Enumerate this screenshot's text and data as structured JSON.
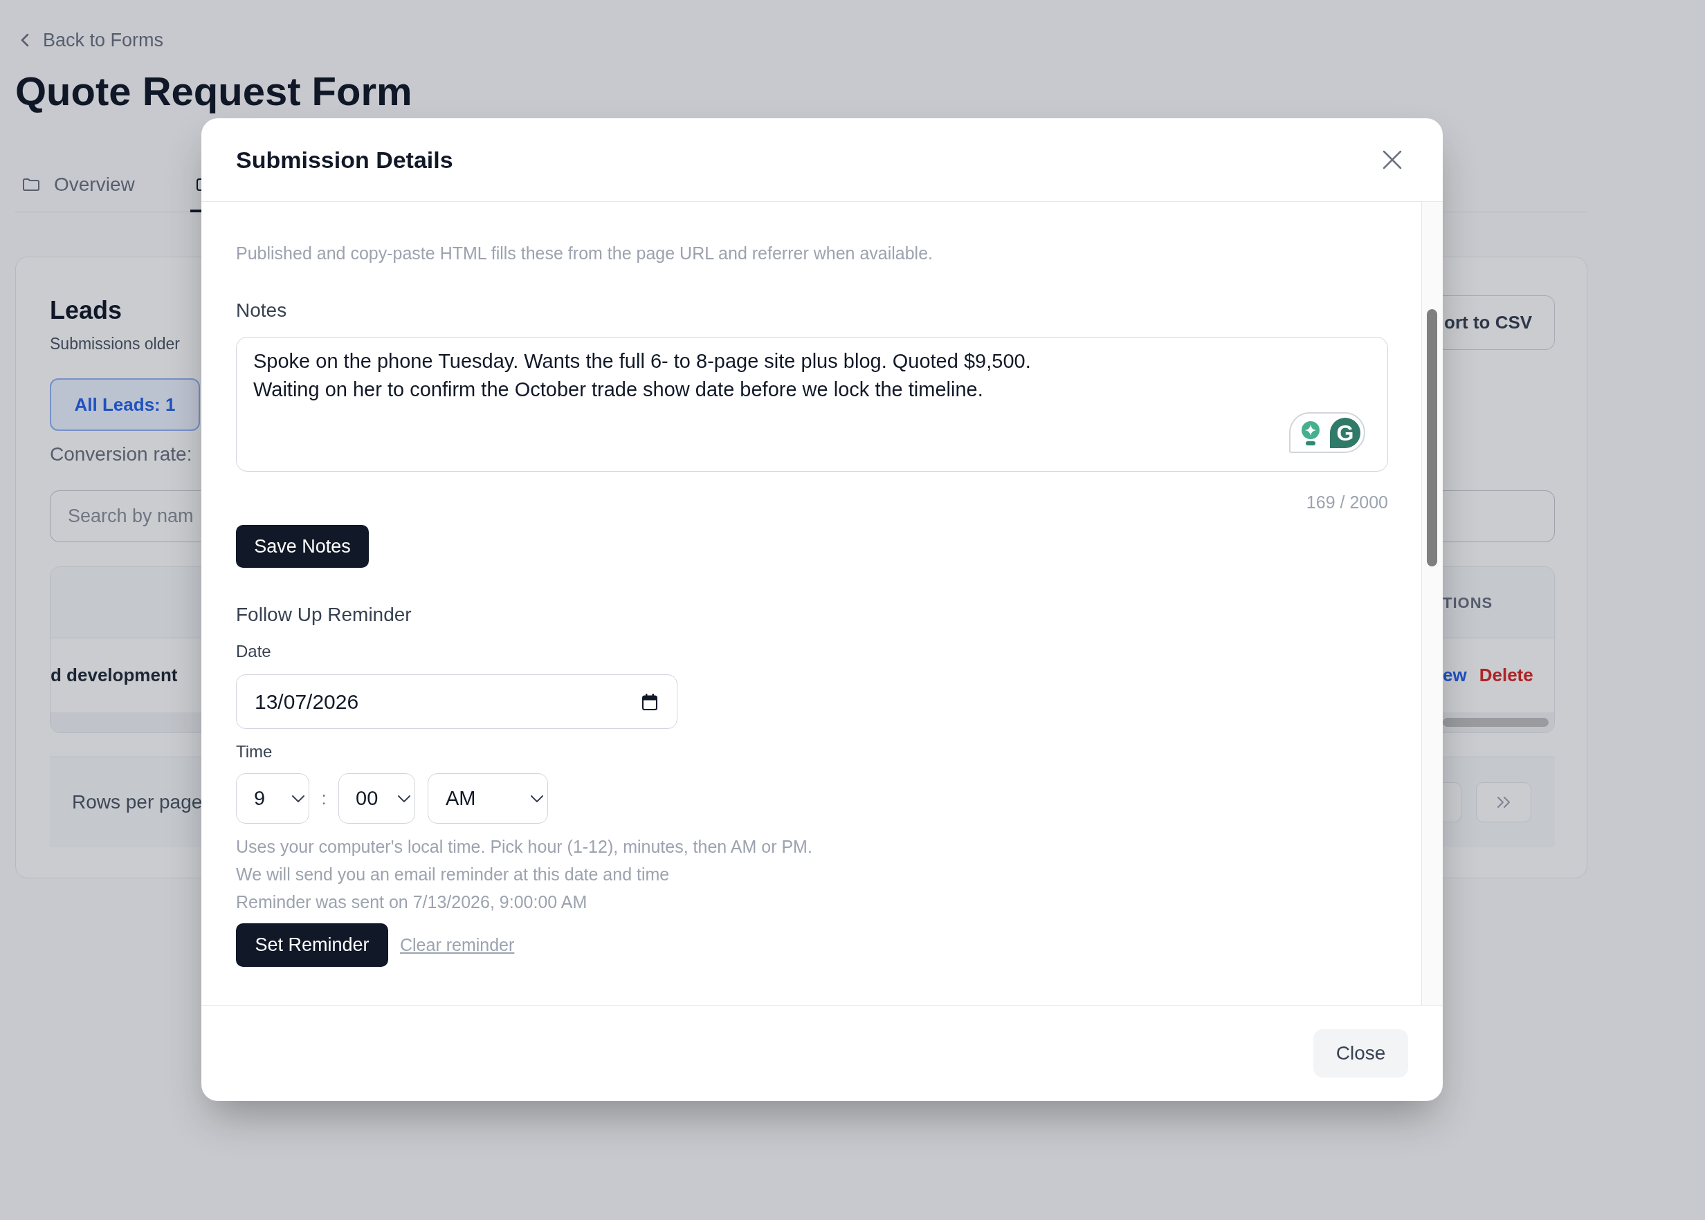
{
  "page": {
    "back_link": "Back to Forms",
    "title": "Quote Request Form",
    "tabs": [
      {
        "label": "Overview",
        "selected": false
      },
      {
        "selected": true
      }
    ],
    "leads_card": {
      "title": "Leads",
      "subtitle": "Submissions older",
      "export_button": "ort to CSV",
      "filter_chip": {
        "label": "All Leads: 1",
        "selected": true
      },
      "conversion_rate": "Conversion rate:",
      "search": {
        "placeholder": "Search by nam"
      },
      "table": {
        "column_heading": "TIONS",
        "rows": [
          {
            "column_1": "d development",
            "actions": [
              {
                "label": "ew",
                "kind": "link"
              },
              {
                "label": "Delete",
                "kind": "danger"
              }
            ]
          }
        ]
      },
      "pagination": {
        "rows_per_page_label": "Rows per page"
      }
    }
  },
  "dialog": {
    "title": "Submission Details",
    "intro": "Published and copy-paste HTML fills these from the page URL and referrer when available.",
    "notes": {
      "label": "Notes",
      "value": "Spoke on the phone Tuesday. Wants the full 6- to 8-page site plus blog. Quoted $9,500.\nWaiting on her to confirm the October trade show date before we lock the timeline.",
      "assistant_logo": "G",
      "counter": "169 / 2000",
      "save_button": "Save Notes"
    },
    "reminder": {
      "heading": "Follow Up Reminder",
      "date": {
        "label": "Date",
        "value": "13/07/2026"
      },
      "time": {
        "label": "Time",
        "hour": "9",
        "separator": ":",
        "minute": "00",
        "period": "AM"
      },
      "hints": [
        "Uses your computer's local time. Pick hour (1-12), minutes, then AM or PM.",
        "We will send you an email reminder at this date and time",
        "Reminder was sent on 7/13/2026, 9:00:00 AM"
      ],
      "set_button": "Set Reminder",
      "clear_link": "Clear reminder"
    },
    "close_button": "Close"
  }
}
